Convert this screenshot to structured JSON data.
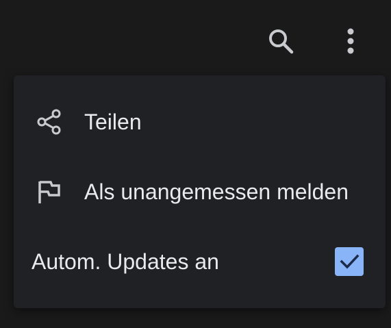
{
  "toolbar": {
    "search_icon": "search-icon",
    "more_icon": "more-vert-icon"
  },
  "menu": {
    "items": [
      {
        "label": "Teilen",
        "icon": "share-icon"
      },
      {
        "label": "Als unangemessen melden",
        "icon": "flag-icon"
      },
      {
        "label": "Autom. Updates an",
        "checked": true
      }
    ]
  },
  "colors": {
    "background": "#1a1a1b",
    "menu_surface": "#202124",
    "text": "#e8eaed",
    "icon": "#c8cacd",
    "checkbox_fill": "#8ab4f8",
    "checkmark": "#1a2a4a"
  }
}
